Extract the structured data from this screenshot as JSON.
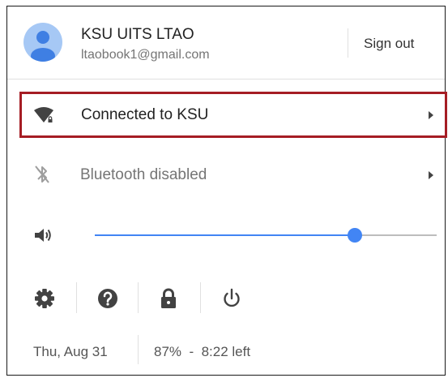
{
  "header": {
    "user_name": "KSU UITS LTAO",
    "user_email": "ltaobook1@gmail.com",
    "sign_out_label": "Sign out",
    "avatar_color": "#a6c8f5",
    "avatar_figure_color": "#3f7fe3"
  },
  "network": {
    "label": "Connected to KSU",
    "icon": "wifi-locked-icon",
    "highlight_color": "#a51d24"
  },
  "bluetooth": {
    "label": "Bluetooth disabled",
    "icon": "bluetooth-disabled-icon"
  },
  "volume": {
    "icon": "speaker-icon",
    "level_fraction": 0.76,
    "accent_color": "#4285f4"
  },
  "system_buttons": [
    {
      "name": "settings",
      "icon": "gear-icon"
    },
    {
      "name": "help",
      "icon": "help-icon"
    },
    {
      "name": "lock",
      "icon": "lock-icon"
    },
    {
      "name": "power",
      "icon": "power-icon"
    }
  ],
  "status": {
    "date": "Thu, Aug 31",
    "battery": "87%  -  8:22 left"
  }
}
